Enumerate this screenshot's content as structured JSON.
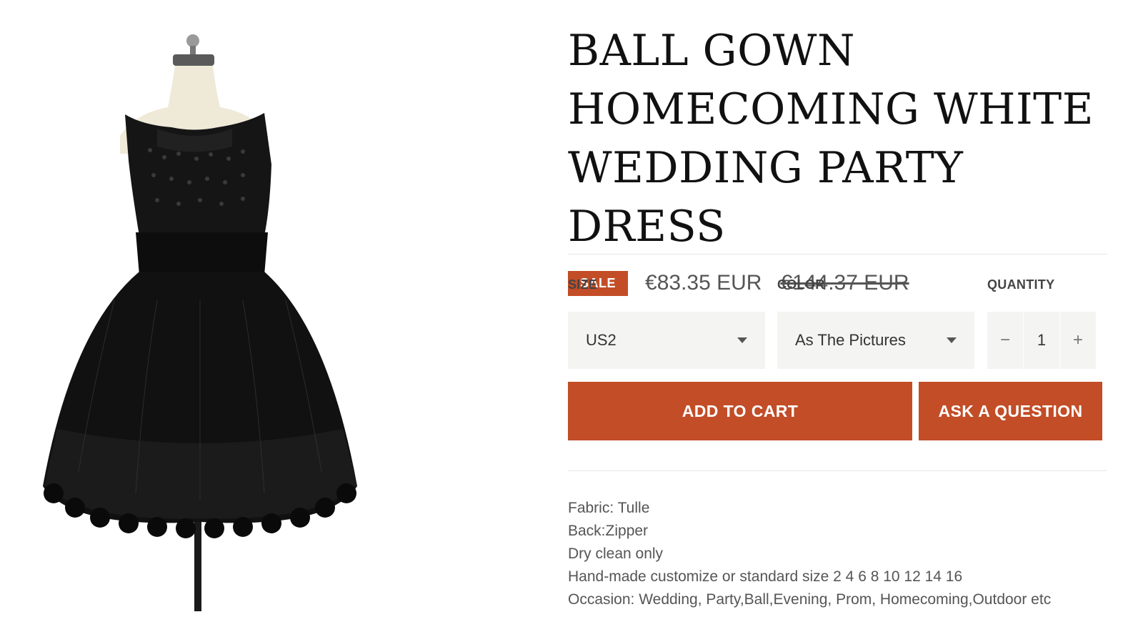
{
  "product": {
    "title": "BALL GOWN\nHOMECOMING WHITE\nWEDDING PARTY DRESS",
    "badge": "SALE",
    "price": "€83.35 EUR",
    "compare_price": "€144.37 EUR",
    "image_alt": "black-tulle-dress-on-mannequin"
  },
  "options": {
    "size_label": "SIZE",
    "size_value": "US2",
    "color_label": "COLOR",
    "color_value": "As The Pictures",
    "quantity_label": "QUANTITY",
    "quantity_value": "1",
    "minus": "−",
    "plus": "+"
  },
  "actions": {
    "add_to_cart": "ADD TO CART",
    "ask_question": "ASK A QUESTION"
  },
  "description": [
    "Fabric: Tulle",
    "Back:Zipper",
    "Dry clean only",
    "Hand-made customize or standard size 2 4 6 8 10 12 14 16",
    "Occasion: Wedding, Party,Ball,Evening, Prom, Homecoming,Outdoor etc"
  ],
  "colors": {
    "accent": "#c24d27",
    "select_bg": "#f4f4f2"
  }
}
